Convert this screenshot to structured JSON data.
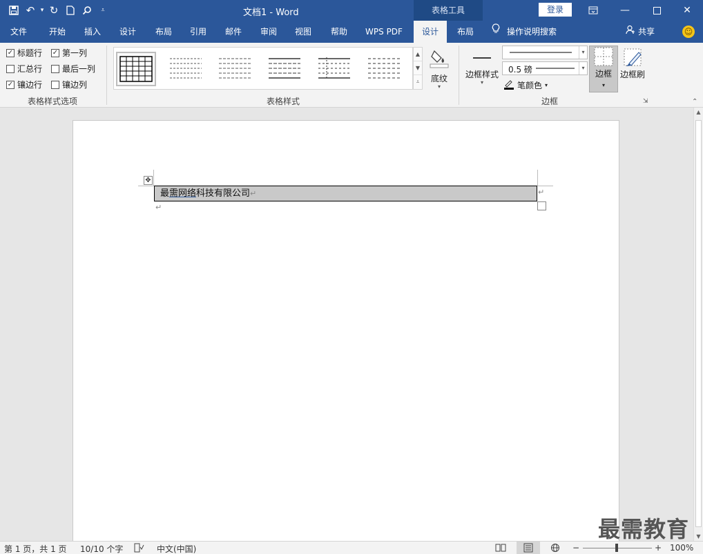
{
  "titlebar": {
    "title": "文档1  -  Word",
    "context_tab": "表格工具",
    "login": "登录"
  },
  "tabs": [
    "文件",
    "开始",
    "插入",
    "设计",
    "布局",
    "引用",
    "邮件",
    "审阅",
    "视图",
    "帮助",
    "WPS PDF",
    "设计",
    "布局"
  ],
  "tell_me": "操作说明搜索",
  "share": "共享",
  "ribbon": {
    "options": {
      "header_row": "标题行",
      "first_column": "第一列",
      "total_row": "汇总行",
      "last_column": "最后一列",
      "banded_rows": "镶边行",
      "banded_columns": "镶边列",
      "group_label": "表格样式选项"
    },
    "styles": {
      "group_label": "表格样式",
      "shading": "底纹"
    },
    "borders": {
      "border_styles": "边框样式",
      "pen_weight": "0.5 磅",
      "pen_color": "笔颜色",
      "borders_btn": "边框",
      "border_painter": "边框刷",
      "group_label": "边框"
    }
  },
  "document": {
    "cell_text_a": "最",
    "cell_text_b": "需网络",
    "cell_text_c": "科技有限公司"
  },
  "watermark": "最需教育",
  "status": {
    "page": "第 1 页，共 1 页",
    "words": "10/10 个字",
    "language": "中文(中国)",
    "zoom": "100%"
  }
}
